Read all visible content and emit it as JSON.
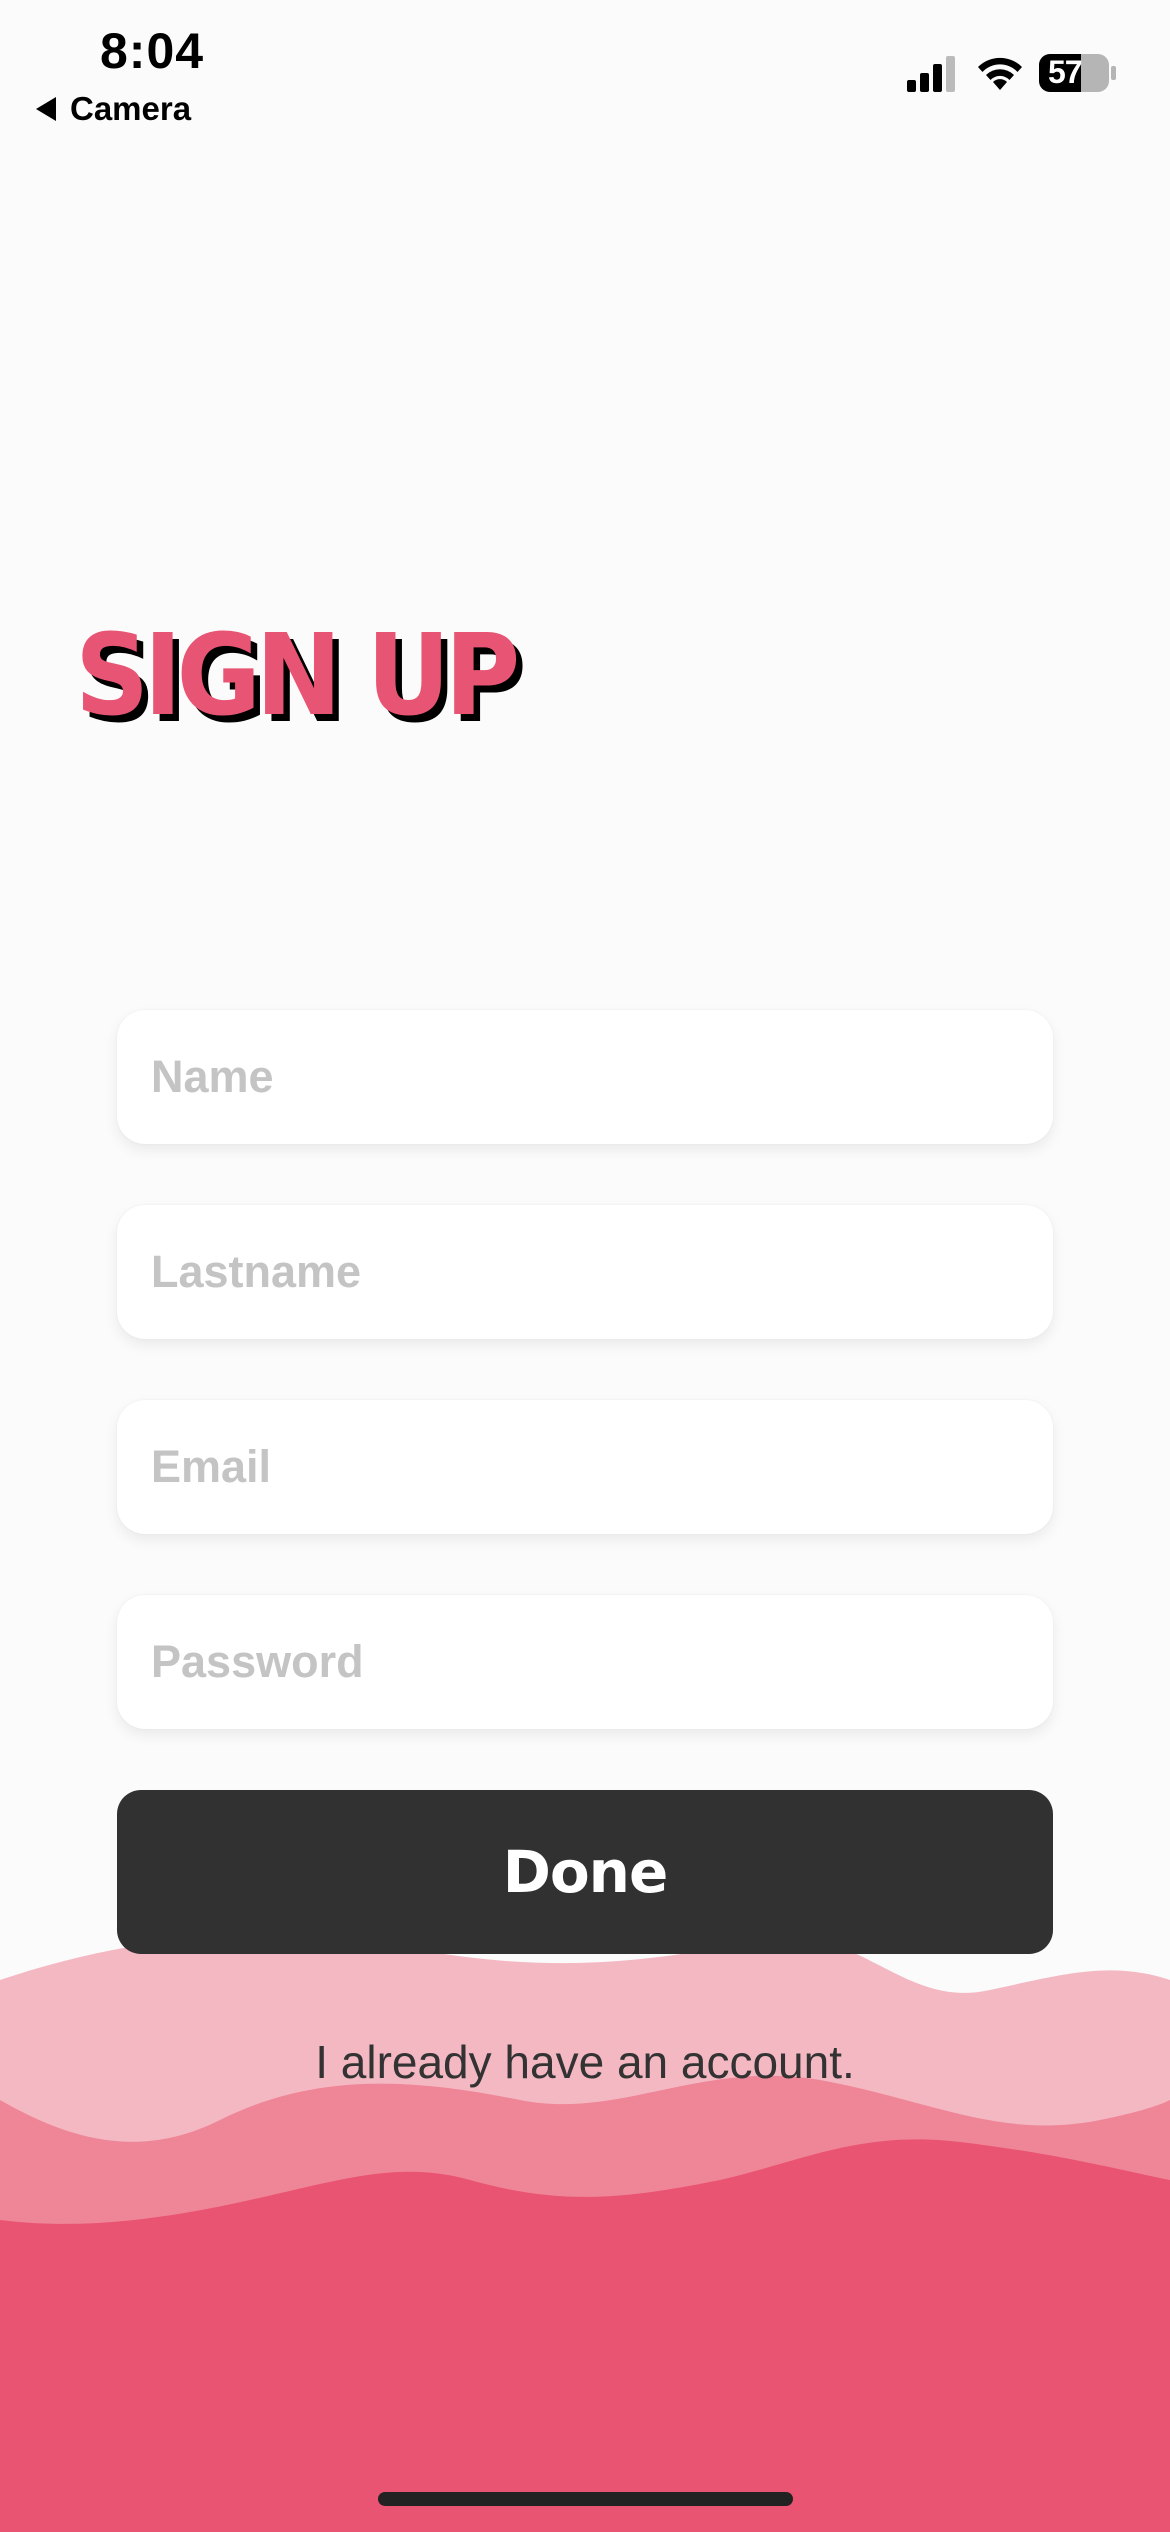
{
  "status_bar": {
    "time": "8:04",
    "back_label": "Camera",
    "battery_level": "57"
  },
  "title": "SIGN UP",
  "form": {
    "name_placeholder": "Name",
    "lastname_placeholder": "Lastname",
    "email_placeholder": "Email",
    "password_placeholder": "Password",
    "done_label": "Done",
    "login_link": "I already have an account."
  },
  "colors": {
    "accent": "#e85473",
    "wave_light": "#f4b8c3",
    "wave_mid": "#ee8697",
    "wave_dark": "#ea5473",
    "button_dark": "#323131"
  }
}
